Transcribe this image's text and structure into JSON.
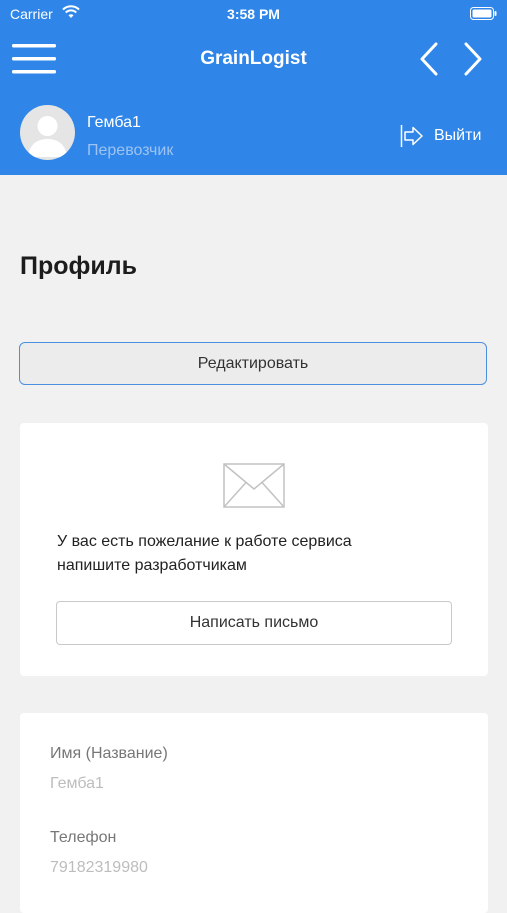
{
  "status_bar": {
    "carrier": "Carrier",
    "time": "3:58 PM"
  },
  "header": {
    "title": "GrainLogist",
    "menu_icon": "hamburger-menu-icon",
    "back_icon": "chevron-left-icon",
    "forward_icon": "chevron-right-icon",
    "accent_color": "#2f86e8"
  },
  "user": {
    "name": "Гемба1",
    "role": "Перевозчик",
    "logout_label": "Выйти"
  },
  "main": {
    "page_title": "Профиль",
    "edit_label": "Редактировать"
  },
  "feedback": {
    "line1": "У вас есть пожелание к работе сервиса",
    "line2": "напишите разработчикам",
    "button_label": "Написать письмо"
  },
  "profile_fields": [
    {
      "label": "Имя (Название)",
      "value": "Гемба1"
    },
    {
      "label": "Телефон",
      "value": "79182319980"
    }
  ]
}
